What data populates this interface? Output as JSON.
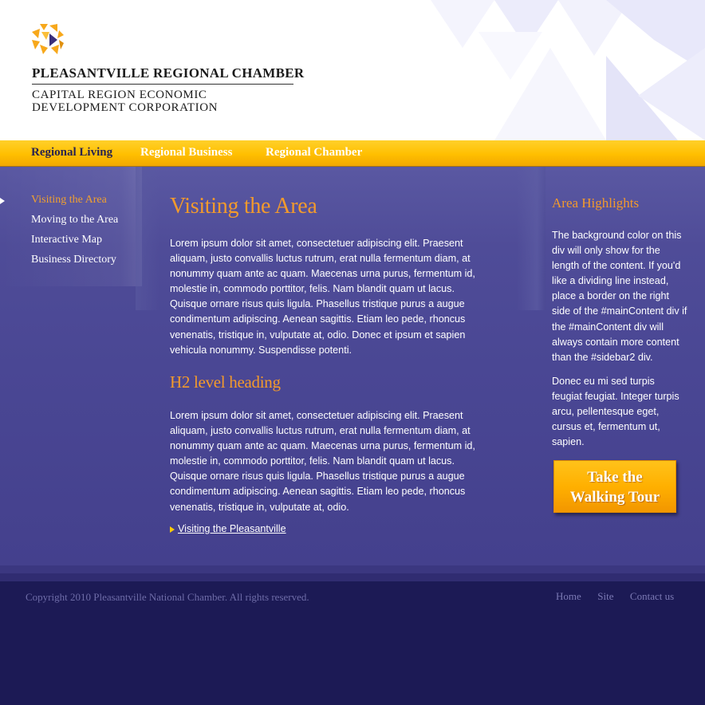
{
  "header": {
    "org_name": "PLEASANTVILLE REGIONAL CHAMBER",
    "org_sub_line1": "CAPITAL REGION ECONOMIC",
    "org_sub_line2": "DEVELOPMENT CORPORATION",
    "logo_icon": "hexagon-cube-logo-icon"
  },
  "topnav": {
    "items": [
      {
        "label": "Regional Living",
        "active": true
      },
      {
        "label": "Regional Business",
        "active": false
      },
      {
        "label": "Regional Chamber",
        "active": false
      }
    ]
  },
  "leftnav": {
    "items": [
      {
        "label": "Visiting the Area",
        "active": true
      },
      {
        "label": "Moving to the Area",
        "active": false
      },
      {
        "label": "Interactive Map",
        "active": false
      },
      {
        "label": "Business Directory",
        "active": false
      }
    ]
  },
  "main": {
    "title": "Visiting the Area",
    "paragraph1": "Lorem ipsum dolor sit amet, consectetuer adipiscing elit. Praesent aliquam, justo convallis luctus rutrum, erat nulla fermentum diam, at nonummy quam ante ac quam. Maecenas urna purus, fermentum id, molestie in, commodo porttitor, felis. Nam blandit quam ut lacus. Quisque ornare risus quis ligula. Phasellus tristique purus a augue condimentum adipiscing. Aenean sagittis. Etiam leo pede, rhoncus venenatis, tristique in, vulputate at, odio. Donec et ipsum et sapien vehicula nonummy. Suspendisse potenti.",
    "h2": "H2 level heading",
    "paragraph2": "Lorem ipsum dolor sit amet, consectetuer adipiscing elit. Praesent aliquam, justo convallis luctus rutrum, erat nulla fermentum diam, at nonummy quam ante ac quam. Maecenas urna purus, fermentum id, molestie in, commodo porttitor, felis. Nam blandit quam ut lacus. Quisque ornare risus quis ligula. Phasellus tristique purus a augue condimentum adipiscing. Aenean sagittis. Etiam leo pede, rhoncus venenatis, tristique in, vulputate at, odio.",
    "link": "Visiting the Pleasantville"
  },
  "sidebar2": {
    "title": "Area Highlights",
    "paragraph1": "The background color on this div will only show for the length of the content. If you'd like a dividing line instead, place a border on the right side of the #mainContent div if the #mainContent div will always contain more content than the #sidebar2 div.",
    "paragraph2": "Donec eu mi sed turpis feugiat feugiat. Integer turpis arcu, pellentesque eget, cursus et, fermentum ut, sapien.",
    "button_line1": "Take the",
    "button_line2": "Walking Tour"
  },
  "footer": {
    "copyright": "Copyright 2010 Pleasantville National Chamber. All rights reserved.",
    "links": [
      "Home",
      "Site",
      "Contact us"
    ]
  },
  "colors": {
    "accent_orange": "#f39a2c",
    "nav_gold": "#ffbf00",
    "content_purple": "#4a4794",
    "footer_navy": "#1c1a55"
  }
}
